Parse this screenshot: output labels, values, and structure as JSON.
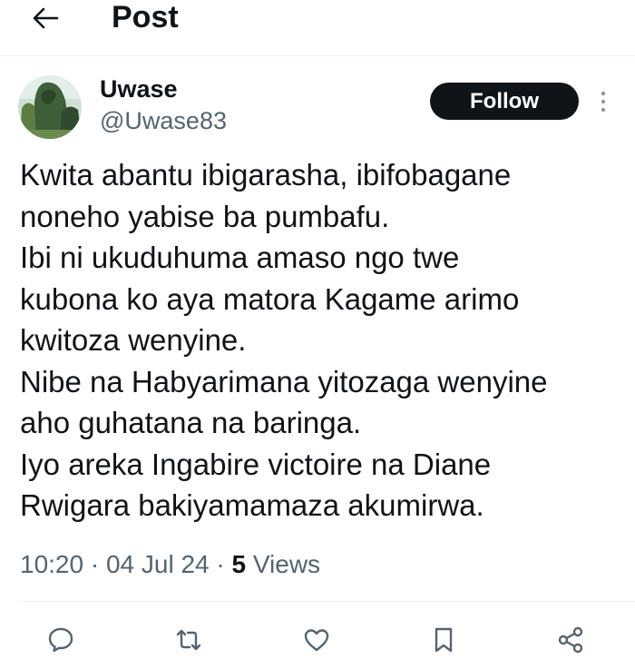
{
  "header": {
    "back_icon": "arrow-left-icon",
    "title": "Post"
  },
  "post": {
    "author": {
      "name": "Uwase",
      "handle": "@Uwase83",
      "avatar_icon": "avatar-tree-photo"
    },
    "follow_label": "Follow",
    "more_icon": "more-vertical-icon",
    "lines": [
      "Kwita abantu ibigarasha, ibifobagane",
      "noneho yabise ba pumbafu.",
      "Ibi ni ukuduhuma amaso ngo twe",
      "kubona ko aya matora Kagame arimo",
      "kwitoza wenyine.",
      "Nibe na Habyarimana yitozaga wenyine",
      "aho guhatana na baringa.",
      "Iyo areka Ingabire victoire na Diane",
      "Rwigara bakiyamamaza akumirwa."
    ],
    "time": "10:20",
    "date": "04 Jul 24",
    "views_count": "5",
    "views_label": "Views",
    "separator": "·"
  },
  "actions": [
    {
      "icon": "reply-icon"
    },
    {
      "icon": "repost-icon"
    },
    {
      "icon": "like-icon"
    },
    {
      "icon": "bookmark-icon"
    },
    {
      "icon": "share-icon"
    }
  ],
  "colors": {
    "text": "#0f1419",
    "secondary": "#536471",
    "follow_bg": "#0f1419",
    "divider": "#eff3f4"
  }
}
